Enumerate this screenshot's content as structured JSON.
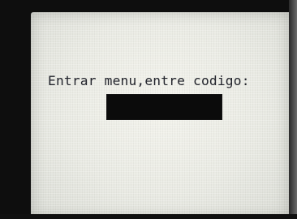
{
  "screen": {
    "prompt": "Entrar menu,entre codigo:",
    "code_value": ""
  },
  "colors": {
    "screen_background": "#e9eae3",
    "text": "#22242c",
    "input_field": "#0b0b0b"
  }
}
